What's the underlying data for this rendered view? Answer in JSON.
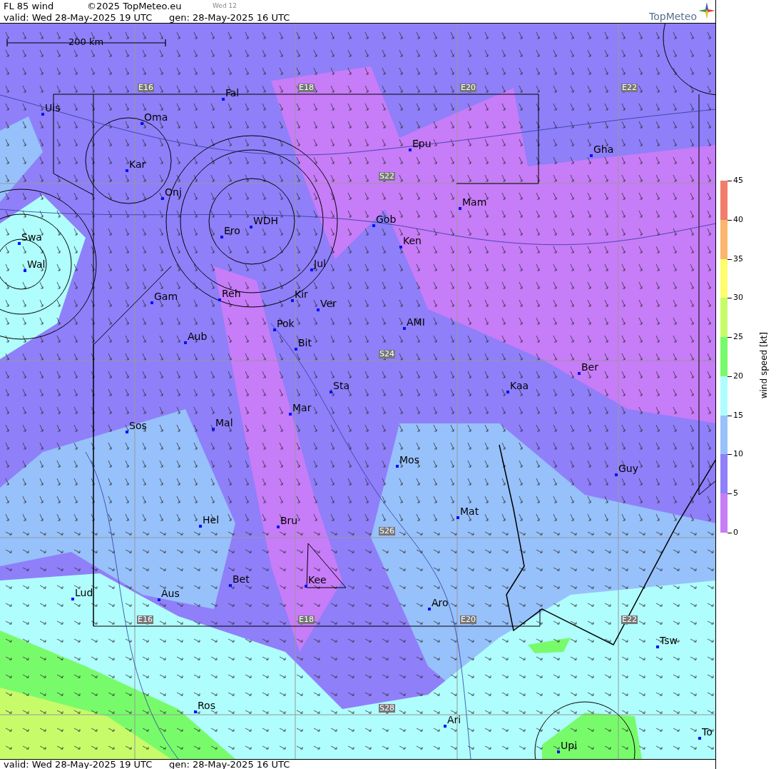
{
  "header": {
    "title": "FL 85 wind",
    "copyright": "©2025 TopMeteo.eu",
    "day_tag": "Wed 12",
    "valid": "valid:  Wed  28-May-2025  19 UTC",
    "generated": "gen: 28-May-2025 16 UTC",
    "logo": "TopMeteo"
  },
  "map": {
    "scale": "200 km",
    "grid_labels": [
      "E16",
      "E18",
      "E20",
      "E22",
      "S22",
      "S24",
      "S26",
      "S28",
      "E16",
      "E18",
      "E20",
      "E22"
    ],
    "places": [
      {
        "name": "Uis"
      },
      {
        "name": "Fal"
      },
      {
        "name": "Oma"
      },
      {
        "name": "Kar"
      },
      {
        "name": "Epu"
      },
      {
        "name": "Gha"
      },
      {
        "name": "Onj"
      },
      {
        "name": "Mam"
      },
      {
        "name": "Gob"
      },
      {
        "name": "Swa"
      },
      {
        "name": "Ero"
      },
      {
        "name": "WDH"
      },
      {
        "name": "Ken"
      },
      {
        "name": "Wal"
      },
      {
        "name": "Jul"
      },
      {
        "name": "Gam"
      },
      {
        "name": "Reh"
      },
      {
        "name": "Kir"
      },
      {
        "name": "Ver"
      },
      {
        "name": "AMI"
      },
      {
        "name": "Pok"
      },
      {
        "name": "Bit"
      },
      {
        "name": "Aub"
      },
      {
        "name": "Ber"
      },
      {
        "name": "Sta"
      },
      {
        "name": "Kaa"
      },
      {
        "name": "Mar"
      },
      {
        "name": "Sos"
      },
      {
        "name": "Mal"
      },
      {
        "name": "Mos"
      },
      {
        "name": "Guy"
      },
      {
        "name": "Mat"
      },
      {
        "name": "Hel"
      },
      {
        "name": "Bru"
      },
      {
        "name": "Bet"
      },
      {
        "name": "Kee"
      },
      {
        "name": "Lud"
      },
      {
        "name": "Aus"
      },
      {
        "name": "Aro"
      },
      {
        "name": "Tsw"
      },
      {
        "name": "Ros"
      },
      {
        "name": "Ari"
      },
      {
        "name": "To"
      },
      {
        "name": "Upi"
      }
    ]
  },
  "legend": {
    "title": "wind speed [kt]",
    "ticks": [
      "45",
      "40",
      "35",
      "30",
      "25",
      "20",
      "15",
      "10",
      "5",
      "0"
    ],
    "bands": [
      {
        "color": "#f27d6b"
      },
      {
        "color": "#fbb56c"
      },
      {
        "color": "#fdfd6d"
      },
      {
        "color": "#c8fb6a"
      },
      {
        "color": "#78fb6b"
      },
      {
        "color": "#b0fdfd"
      },
      {
        "color": "#97c1fb"
      },
      {
        "color": "#8f7ff9"
      },
      {
        "color": "#c77cf8"
      }
    ]
  },
  "footer": {
    "valid": "valid:  Wed  28-May-2025  19 UTC",
    "generated": "gen: 28-May-2025 16 UTC"
  }
}
